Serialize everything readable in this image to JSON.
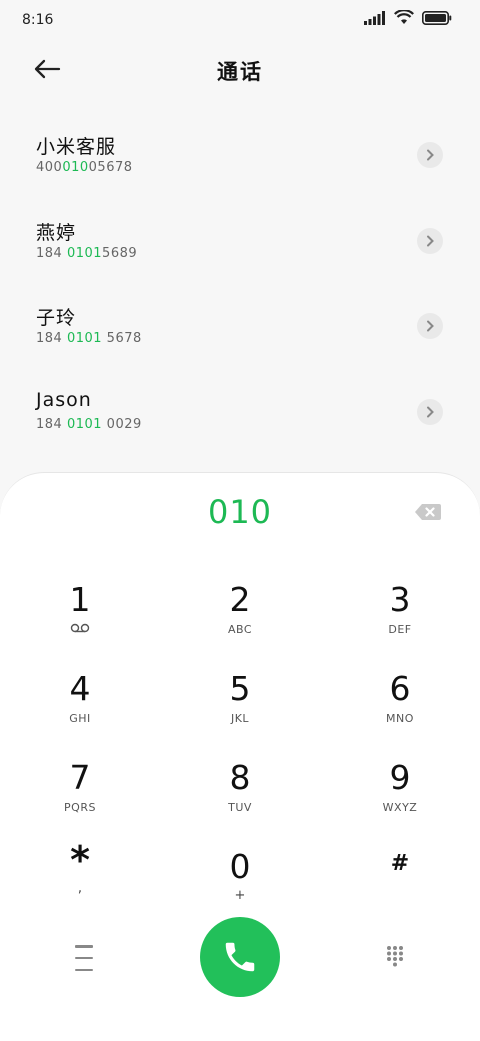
{
  "status_bar": {
    "time": "8:16"
  },
  "header": {
    "title": "通话"
  },
  "contacts": [
    {
      "name": "小米客服",
      "number_pre": "400",
      "number_match": "010",
      "number_post": "05678"
    },
    {
      "name": "燕婷",
      "number_pre": "184 ",
      "number_match": "0101",
      "number_post": "5689"
    },
    {
      "name": "子玲",
      "number_pre": "184 ",
      "number_match": "0101",
      "number_post": " 5678"
    },
    {
      "name": "Jason",
      "number_pre": "184 ",
      "number_match": "0101",
      "number_post": " 0029"
    }
  ],
  "dialer": {
    "input": "010",
    "keys": [
      {
        "digit": "1",
        "letters": ""
      },
      {
        "digit": "2",
        "letters": "ABC"
      },
      {
        "digit": "3",
        "letters": "DEF"
      },
      {
        "digit": "4",
        "letters": "GHI"
      },
      {
        "digit": "5",
        "letters": "JKL"
      },
      {
        "digit": "6",
        "letters": "MNO"
      },
      {
        "digit": "7",
        "letters": "PQRS"
      },
      {
        "digit": "8",
        "letters": "TUV"
      },
      {
        "digit": "9",
        "letters": "WXYZ"
      },
      {
        "digit": "*",
        "letters": ","
      },
      {
        "digit": "0",
        "letters": "+"
      },
      {
        "digit": "#",
        "letters": ""
      }
    ]
  },
  "colors": {
    "accent": "#1db954",
    "call_button": "#22c05a"
  },
  "icons": {
    "voicemail": "voicemail-icon",
    "back": "back-arrow-icon",
    "delete": "backspace-icon",
    "call": "phone-icon",
    "menu": "menu-icon",
    "keypad": "keypad-icon"
  }
}
